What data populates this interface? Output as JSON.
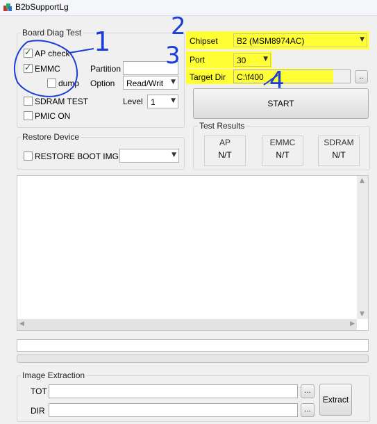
{
  "window": {
    "title": "B2bSupportLg"
  },
  "board_diag": {
    "legend": "Board Diag Test",
    "ap_check": {
      "label": "AP check",
      "checked": true
    },
    "emmc": {
      "label": "EMMC",
      "checked": true
    },
    "dump": {
      "label": "dump",
      "checked": false
    },
    "partition_label": "Partition",
    "partition_value": "",
    "option_label": "Option",
    "option_value": "Read/Writ",
    "sdram_test": {
      "label": "SDRAM TEST",
      "checked": false
    },
    "pmic_on": {
      "label": "PMIC ON",
      "checked": false
    },
    "level_label": "Level",
    "level_value": "1"
  },
  "restore": {
    "legend": "Restore Device",
    "restore_boot": {
      "label": "RESTORE BOOT IMG",
      "checked": false
    },
    "image_value": ""
  },
  "settings": {
    "chipset_label": "Chipset",
    "chipset_value": "B2 (MSM8974AC)",
    "port_label": "Port",
    "port_value": "30",
    "target_dir_label": "Target Dir",
    "target_dir_value": "C:\\f400",
    "browse_label": "..",
    "start_label": "START"
  },
  "test_results": {
    "legend": "Test Results",
    "items": [
      {
        "title": "AP",
        "value": "N/T"
      },
      {
        "title": "EMMC",
        "value": "N/T"
      },
      {
        "title": "SDRAM",
        "value": "N/T"
      }
    ]
  },
  "image_extraction": {
    "legend": "Image Extraction",
    "tot_label": "TOT",
    "tot_value": "",
    "dir_label": "DIR",
    "dir_value": "",
    "browse_label": "...",
    "extract_label": "Extract"
  },
  "annotations": [
    "1",
    "2",
    "3",
    "4"
  ],
  "colors": {
    "highlight": "#ffff33",
    "annotation_ink": "#1b3fd6"
  }
}
